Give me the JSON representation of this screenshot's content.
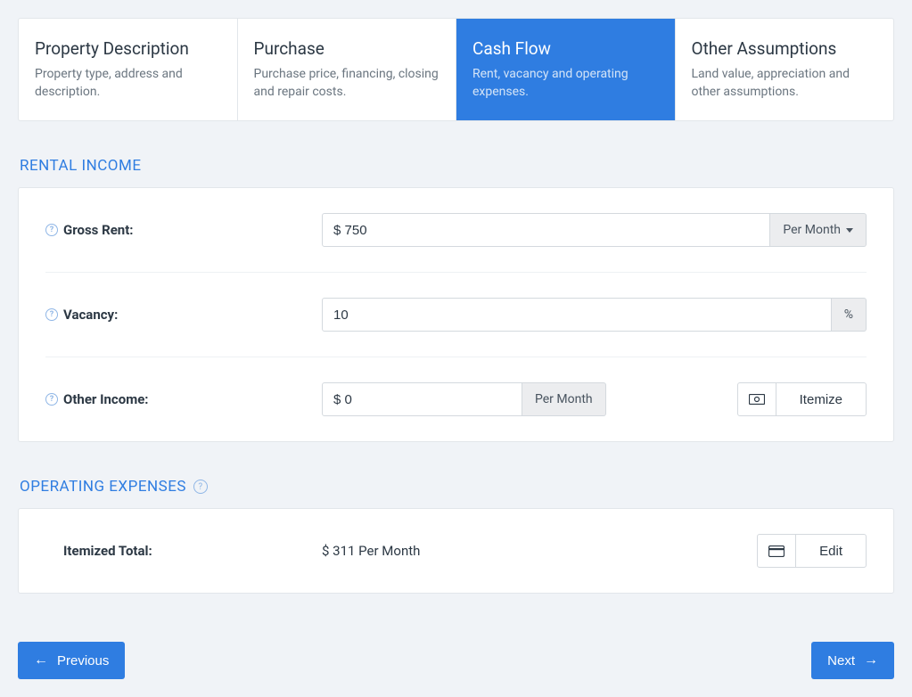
{
  "tabs": [
    {
      "title": "Property Description",
      "desc": "Property type, address and description."
    },
    {
      "title": "Purchase",
      "desc": "Purchase price, financing, closing and repair costs."
    },
    {
      "title": "Cash Flow",
      "desc": "Rent, vacancy and operating expenses."
    },
    {
      "title": "Other Assumptions",
      "desc": "Land value, appreciation and other assumptions."
    }
  ],
  "sections": {
    "rental_income": {
      "title": "RENTAL INCOME"
    },
    "operating_expenses": {
      "title": "OPERATING EXPENSES"
    }
  },
  "gross_rent": {
    "label": "Gross Rent:",
    "value": "$ 750",
    "period": "Per Month"
  },
  "vacancy": {
    "label": "Vacancy:",
    "value": "10",
    "unit": "%"
  },
  "other_income": {
    "label": "Other Income:",
    "value": "$ 0",
    "period": "Per Month",
    "action": "Itemize"
  },
  "itemized_total": {
    "label": "Itemized Total:",
    "value": "$ 311 Per Month",
    "action": "Edit"
  },
  "nav": {
    "prev": "Previous",
    "next": "Next"
  }
}
